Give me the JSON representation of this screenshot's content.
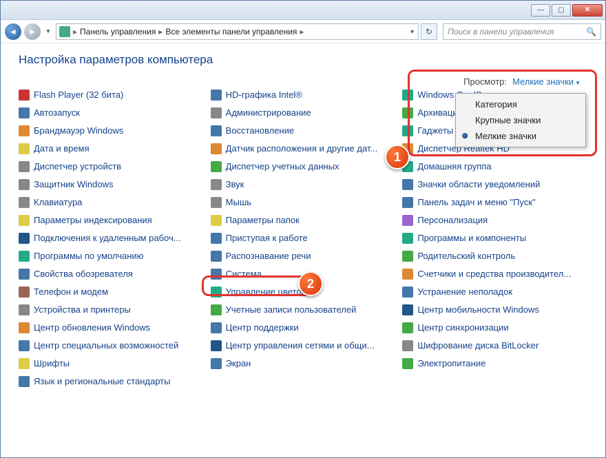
{
  "window": {
    "min": "—",
    "max": "▢",
    "close": "✕"
  },
  "nav": {
    "crumb1": "Панель управления",
    "crumb2": "Все элементы панели управления",
    "search_placeholder": "Поиск в панели управления"
  },
  "heading": "Настройка параметров компьютера",
  "view": {
    "label": "Просмотр:",
    "value": "Мелкие значки"
  },
  "dropdown": {
    "opts": [
      "Категория",
      "Крупные значки",
      "Мелкие значки"
    ],
    "selected": 2
  },
  "markers": {
    "m1": "1",
    "m2": "2"
  },
  "items": [
    {
      "label": "Flash Player (32 бита)",
      "c": "ic-red"
    },
    {
      "label": "HD-графика Intel®",
      "c": "ic-blue"
    },
    {
      "label": "Windows CardSpace",
      "c": "ic-teal"
    },
    {
      "label": "Автозапуск",
      "c": "ic-blue"
    },
    {
      "label": "Администрирование",
      "c": "ic-gray"
    },
    {
      "label": "Архивация и восстановление",
      "c": "ic-green"
    },
    {
      "label": "Брандмауэр Windows",
      "c": "ic-orange"
    },
    {
      "label": "Восстановление",
      "c": "ic-blue"
    },
    {
      "label": "Гаджеты рабочего стола",
      "c": "ic-teal"
    },
    {
      "label": "Дата и время",
      "c": "ic-yellow"
    },
    {
      "label": "Датчик расположения и другие дат...",
      "c": "ic-orange"
    },
    {
      "label": "Диспетчер Realtek HD",
      "c": "ic-orange"
    },
    {
      "label": "Диспетчер устройств",
      "c": "ic-gray"
    },
    {
      "label": "Диспетчер учетных данных",
      "c": "ic-green"
    },
    {
      "label": "Домашняя группа",
      "c": "ic-teal"
    },
    {
      "label": "Защитник Windows",
      "c": "ic-gray"
    },
    {
      "label": "Звук",
      "c": "ic-gray"
    },
    {
      "label": "Значки области уведомлений",
      "c": "ic-blue"
    },
    {
      "label": "Клавиатура",
      "c": "ic-gray"
    },
    {
      "label": "Мышь",
      "c": "ic-gray"
    },
    {
      "label": "Панель задач и меню \"Пуск\"",
      "c": "ic-blue"
    },
    {
      "label": "Параметры индексирования",
      "c": "ic-yellow"
    },
    {
      "label": "Параметры папок",
      "c": "ic-yellow"
    },
    {
      "label": "Персонализация",
      "c": "ic-purple"
    },
    {
      "label": "Подключения к удаленным рабоч...",
      "c": "ic-dblue"
    },
    {
      "label": "Приступая к работе",
      "c": "ic-blue"
    },
    {
      "label": "Программы и компоненты",
      "c": "ic-teal"
    },
    {
      "label": "Программы по умолчанию",
      "c": "ic-teal"
    },
    {
      "label": "Распознавание речи",
      "c": "ic-blue"
    },
    {
      "label": "Родительский контроль",
      "c": "ic-green"
    },
    {
      "label": "Свойства обозревателя",
      "c": "ic-blue"
    },
    {
      "label": "Система",
      "c": "ic-blue"
    },
    {
      "label": "Счетчики и средства производител...",
      "c": "ic-orange"
    },
    {
      "label": "Телефон и модем",
      "c": "ic-brown"
    },
    {
      "label": "Управление цветом",
      "c": "ic-teal"
    },
    {
      "label": "Устранение неполадок",
      "c": "ic-blue"
    },
    {
      "label": "Устройства и принтеры",
      "c": "ic-gray"
    },
    {
      "label": "Учетные записи пользователей",
      "c": "ic-green"
    },
    {
      "label": "Центр мобильности Windows",
      "c": "ic-dblue"
    },
    {
      "label": "Центр обновления Windows",
      "c": "ic-orange"
    },
    {
      "label": "Центр поддержки",
      "c": "ic-blue"
    },
    {
      "label": "Центр синхронизации",
      "c": "ic-green"
    },
    {
      "label": "Центр специальных возможностей",
      "c": "ic-blue"
    },
    {
      "label": "Центр управления сетями и общи...",
      "c": "ic-dblue"
    },
    {
      "label": "Шифрование диска BitLocker",
      "c": "ic-gray"
    },
    {
      "label": "Шрифты",
      "c": "ic-yellow"
    },
    {
      "label": "Экран",
      "c": "ic-blue"
    },
    {
      "label": "Электропитание",
      "c": "ic-green"
    },
    {
      "label": "Язык и региональные стандарты",
      "c": "ic-blue"
    }
  ]
}
